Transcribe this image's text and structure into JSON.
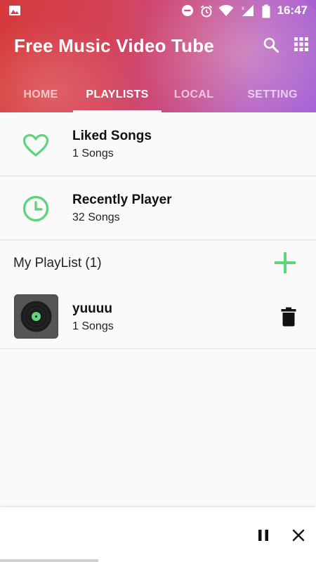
{
  "status_bar": {
    "time": "16:47"
  },
  "header": {
    "title": "Free Music Video Tube",
    "tabs": [
      {
        "label": "HOME"
      },
      {
        "label": "PLAYLISTS"
      },
      {
        "label": "LOCAL"
      },
      {
        "label": "SETTING"
      }
    ],
    "active_tab": "PLAYLISTS"
  },
  "lists": {
    "liked": {
      "title": "Liked Songs",
      "count": "1 Songs"
    },
    "recent": {
      "title": "Recently Player",
      "count": "32 Songs"
    }
  },
  "my_playlist": {
    "label": "My PlayList (1)",
    "items": [
      {
        "name": "yuuuu",
        "count": "1 Songs"
      }
    ]
  },
  "colors": {
    "accent_green": "#5fd47c",
    "header_start": "#d53a3a",
    "header_end": "#a45fd6"
  },
  "icons": [
    "image-icon",
    "dnd-icon",
    "alarm-icon",
    "wifi-icon",
    "signal-icon",
    "battery-icon",
    "search-icon",
    "grid-icon",
    "heart-icon",
    "clock-icon",
    "plus-icon",
    "vinyl-icon",
    "trash-icon",
    "pause-icon",
    "close-icon"
  ]
}
